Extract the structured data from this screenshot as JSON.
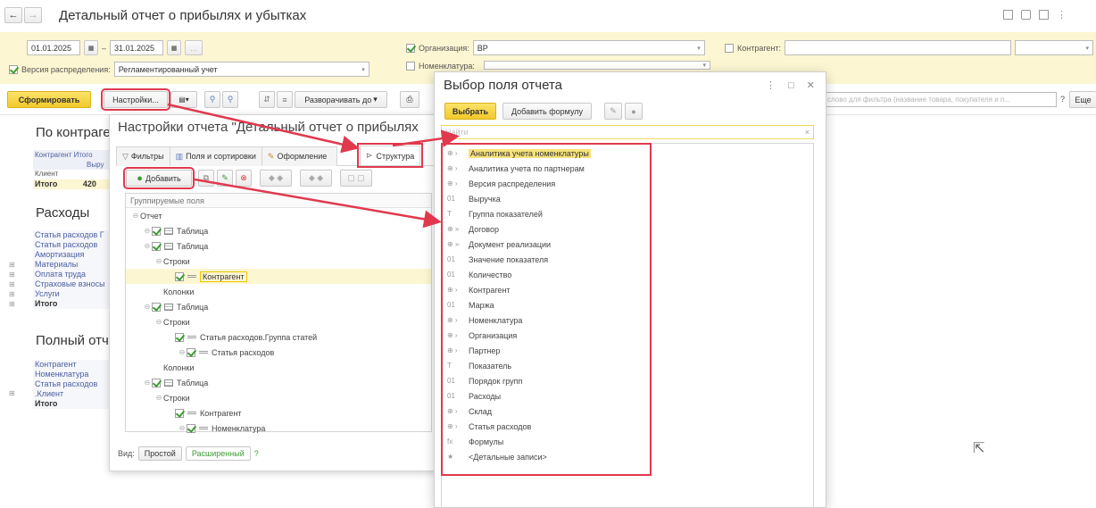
{
  "window": {
    "title": "Детальный отчет о прибылях и убытках",
    "nav_back": "←",
    "nav_forward": "→",
    "more": "⋮"
  },
  "params": {
    "date_from": "01.01.2025",
    "date_sep": "–",
    "date_to": "31.01.2025",
    "period_btn": "...",
    "org_label": "Организация:",
    "org_value": "ВР",
    "contractor_label": "Контрагент:",
    "distribution_label": "Версия распределения:",
    "distribution_value": "Регламентированный учет",
    "nomenclature_label": "Номенклатура:"
  },
  "toolbar": {
    "generate": "Сформировать",
    "settings": "Настройки...",
    "expand": "Разворачивать до",
    "filter_placeholder": "слово для фильтра (название товара, покупателя и п...",
    "help": "?",
    "more": "Еще"
  },
  "report": {
    "section1_title": "По контрагентам",
    "h_contractor": "Контрагент",
    "h_total": "Итого",
    "h_revenue": "Выру",
    "row_client": "Клиент",
    "row_total": "Итого",
    "row_total_value": "420",
    "section2_title": "Расходы",
    "exp_rows": [
      "Статья расходов Г",
      "Статья расходов",
      "Амортизация",
      "Материалы",
      "Оплата труда",
      "Страховые взносы",
      "Услуги",
      "Итого"
    ],
    "section3_title": "Полный отч",
    "full_rows": [
      "Контрагент",
      "Номенклатура",
      "Статья расходов",
      ".Клиент",
      "Итого"
    ]
  },
  "settings_window": {
    "title": "Настройки отчета \"Детальный отчет о прибылях",
    "tab_filters": "Фильтры",
    "tab_fields": "Поля и сортировки",
    "tab_design": "Оформление",
    "tab_structure": "Структура",
    "add_button": "Добавить",
    "tree_header": "Группируемые поля",
    "tree": [
      {
        "level": 0,
        "kind": "exp",
        "text": "Отчет",
        "checked": false
      },
      {
        "level": 1,
        "kind": "table",
        "text": "Таблица",
        "checked": true
      },
      {
        "level": 1,
        "kind": "table",
        "text": "Таблица",
        "checked": true
      },
      {
        "level": 2,
        "kind": "plain-exp",
        "text": "Строки",
        "checked": false
      },
      {
        "level": 3,
        "kind": "field",
        "text": "Контрагент",
        "checked": true,
        "selected": true
      },
      {
        "level": 2,
        "kind": "plain",
        "text": "Колонки",
        "checked": false
      },
      {
        "level": 1,
        "kind": "table",
        "text": "Таблица",
        "checked": true
      },
      {
        "level": 2,
        "kind": "plain-exp",
        "text": "Строки",
        "checked": false
      },
      {
        "level": 3,
        "kind": "field",
        "text": "Статья расходов.Группа статей",
        "checked": true
      },
      {
        "level": 4,
        "kind": "field",
        "text": "Статья расходов",
        "checked": true
      },
      {
        "level": 2,
        "kind": "plain",
        "text": "Колонки",
        "checked": false
      },
      {
        "level": 1,
        "kind": "table",
        "text": "Таблица",
        "checked": true
      },
      {
        "level": 2,
        "kind": "plain-exp",
        "text": "Строки",
        "checked": false
      },
      {
        "level": 3,
        "kind": "field",
        "text": "Контрагент",
        "checked": true
      },
      {
        "level": 4,
        "kind": "field",
        "text": "Номенклатура",
        "checked": true
      }
    ],
    "view_label": "Вид:",
    "view_simple": "Простой",
    "view_extended": "Расширенный",
    "view_help": "?"
  },
  "field_dialog": {
    "title": "Выбор поля отчета",
    "select_button": "Выбрать",
    "add_formula_button": "Добавить формулу",
    "search_placeholder": "Найти",
    "items": [
      {
        "text": "Аналитика учета номенклатуры",
        "icon": "chevron",
        "selected": true
      },
      {
        "text": "Аналитика учета по партнерам",
        "icon": "chevron"
      },
      {
        "text": "Версия распределения",
        "icon": "chevron"
      },
      {
        "text": "Выручка",
        "icon": "number"
      },
      {
        "text": "Группа показателей",
        "icon": "text"
      },
      {
        "text": "Договор",
        "icon": "double-chevron"
      },
      {
        "text": "Документ реализации",
        "icon": "double-chevron"
      },
      {
        "text": "Значение показателя",
        "icon": "number"
      },
      {
        "text": "Количество",
        "icon": "number"
      },
      {
        "text": "Контрагент",
        "icon": "chevron"
      },
      {
        "text": "Маржа",
        "icon": "number"
      },
      {
        "text": "Номенклатура",
        "icon": "chevron"
      },
      {
        "text": "Организация",
        "icon": "chevron"
      },
      {
        "text": "Партнер",
        "icon": "chevron"
      },
      {
        "text": "Показатель",
        "icon": "text"
      },
      {
        "text": "Порядок групп",
        "icon": "number"
      },
      {
        "text": "Расходы",
        "icon": "number"
      },
      {
        "text": "Склад",
        "icon": "chevron"
      },
      {
        "text": "Статья расходов",
        "icon": "chevron"
      },
      {
        "text": "Формулы",
        "icon": "formula"
      },
      {
        "text": "<Детальные записи>",
        "icon": "star"
      }
    ]
  },
  "colors": {
    "accent_yellow": "#f5d23a",
    "highlight_red": "#e0394e",
    "check_green": "#3d9b34"
  }
}
